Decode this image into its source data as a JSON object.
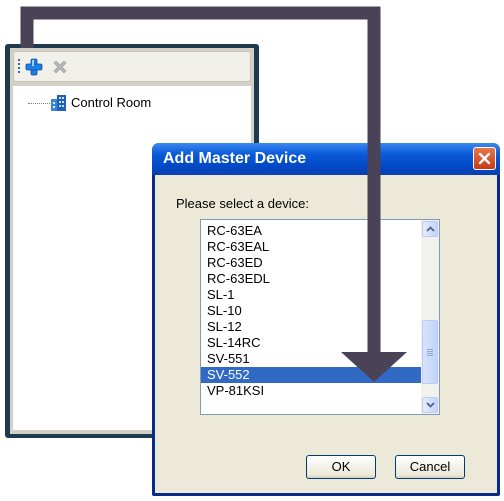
{
  "tree": {
    "items": [
      {
        "label": "Control Room",
        "icon": "building-icon"
      }
    ]
  },
  "toolbar": {
    "icons": [
      "add-icon",
      "delete-icon"
    ]
  },
  "dialog": {
    "title": "Add Master Device",
    "prompt": "Please select a device:",
    "devices": [
      "RC-63EA",
      "RC-63EAL",
      "RC-63ED",
      "RC-63EDL",
      "SL-1",
      "SL-10",
      "SL-12",
      "SL-14RC",
      "SV-551",
      "SV-552",
      "VP-81KSI"
    ],
    "selected": "SV-552",
    "ok_label": "OK",
    "cancel_label": "Cancel"
  },
  "colors": {
    "title_bar": "#0148c4",
    "selection": "#316ac5",
    "arrow": "#4a4358",
    "panel_frame": "#1e3a4e"
  }
}
